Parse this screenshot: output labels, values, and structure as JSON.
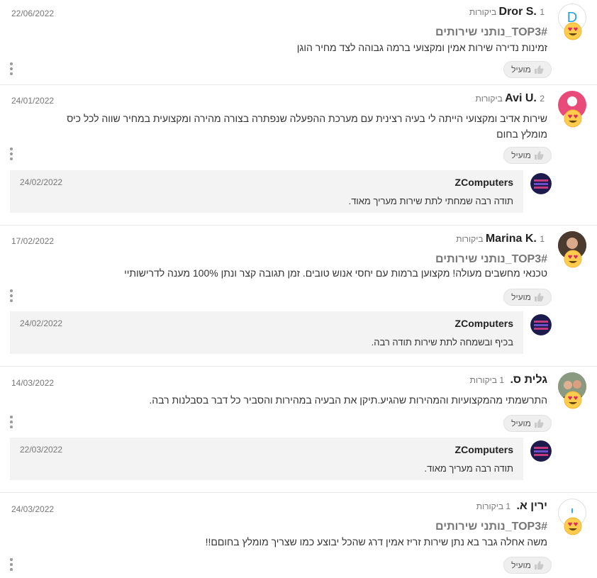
{
  "helpful_label": "מועיל",
  "reviews": [
    {
      "name": "Dror S.",
      "count": "1 ביקורות",
      "date": "22/06/2022",
      "tag": "#TOP3_נותני שירותים",
      "text": "זמינות נדירה שירות אמין ומקצועי ברמה גבוהה לצד מחיר הוגן",
      "avatar_letter": "D",
      "avatar_color": "#2a9fd8"
    },
    {
      "name": "Avi U.",
      "count": "2 ביקורות",
      "date": "24/01/2022",
      "text": "שירות אדיב ומקצועי הייתה לי בעיה רצינית עם מערכת ההפעלה שנפתרה בצורה מהירה ומקצועית במחיר שווה לכל כיס מומלץ בחום",
      "avatar_color": "#e84a7a",
      "reply": {
        "name": "ZComputers",
        "date": "24/02/2022",
        "text": "תודה רבה שמחתי לתת שירות מעריך מאוד."
      }
    },
    {
      "name": "Marina K.",
      "count": "1 ביקורות",
      "date": "17/02/2022",
      "tag": "#TOP3_נותני שירותים",
      "text": "טכנאי מחשבים מעולה! מקצוען ברמות עם יחסי אנוש טובים. זמן תגובה קצר ונתן 100% מענה לדרישותיי",
      "reply": {
        "name": "ZComputers",
        "date": "24/02/2022",
        "text": "בכיף ובשמחה לתת שירות תודה רבה."
      }
    },
    {
      "name": "גלית ס.",
      "count": "1 ביקורות",
      "date": "14/03/2022",
      "text": "התרשמתי מהמקצועיות והמהירות שהגיע.תיקן את הבעיה במהירות והסביר כל דבר בסבלנות רבה.",
      "reply": {
        "name": "ZComputers",
        "date": "22/03/2022",
        "text": "תודה רבה מעריך מאוד."
      }
    },
    {
      "name": "ירין א.",
      "count": "1 ביקורות",
      "date": "24/03/2022",
      "tag": "#TOP3_נותני שירותים",
      "text": "משה אחלה גבר בא נתן שירות זריז אמין דרג שהכל יבוצע כמו שצריך מומלץ בחוםם!!",
      "avatar_letter": "י",
      "avatar_color": "#2a9fd8"
    }
  ]
}
